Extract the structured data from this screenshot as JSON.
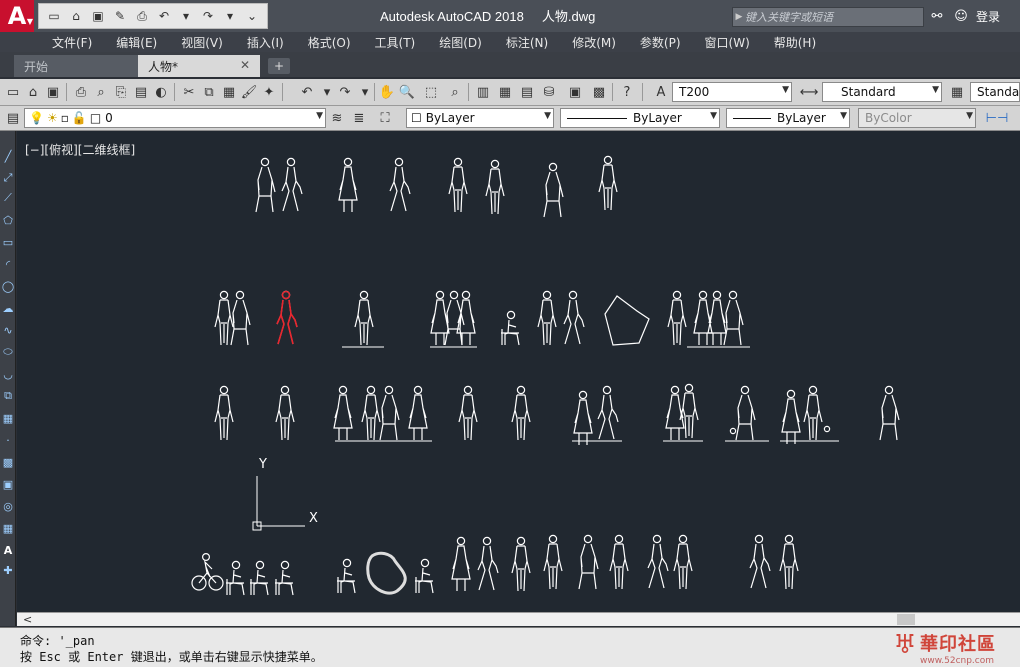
{
  "app": {
    "logo_letter": "A",
    "title": "Autodesk AutoCAD 2018",
    "document": "人物.dwg"
  },
  "search": {
    "placeholder": "键入关键字或短语"
  },
  "user": {
    "login_label": "登录"
  },
  "menu": [
    "文件(F)",
    "编辑(E)",
    "视图(V)",
    "插入(I)",
    "格式(O)",
    "工具(T)",
    "绘图(D)",
    "标注(N)",
    "修改(M)",
    "参数(P)",
    "窗口(W)",
    "帮助(H)"
  ],
  "tabs": {
    "start": "开始",
    "active": "人物*"
  },
  "toolbar": {
    "text_style": "T200",
    "dim_style": "Standard",
    "table_style": "Standar"
  },
  "layers": {
    "current_layer": "0",
    "color": "ByLayer",
    "linetype": "ByLayer",
    "lineweight": "ByLayer",
    "plot_style": "ByColor"
  },
  "viewport": {
    "label": "[−][俯视][二维线框]"
  },
  "ucs": {
    "x_label": "X",
    "y_label": "Y"
  },
  "command": {
    "line1": "命令: '_pan",
    "line2": "按 Esc 或 Enter 键退出，或单击右键显示快捷菜单。"
  },
  "watermark": {
    "name": "華印社區",
    "url": "www.52cnp.com"
  },
  "colors": {
    "canvas": "#212830",
    "figure": "#ffffff",
    "selected": "#e8262e",
    "accent": "#c8102e"
  }
}
